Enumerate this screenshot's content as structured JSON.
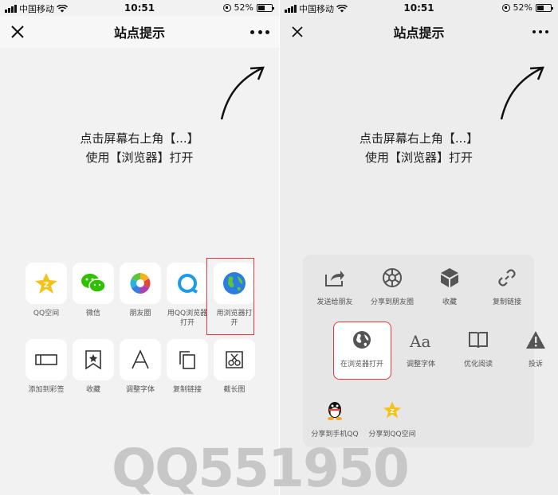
{
  "status": {
    "carrier": "中国移动",
    "time": "10:51",
    "battery": "52%"
  },
  "nav": {
    "title": "站点提示"
  },
  "hint": {
    "line1": "点击屏幕右上角【...】",
    "line2": "使用【浏览器】打开"
  },
  "left_share": {
    "row1": [
      {
        "label": "QQ空间",
        "icon": "qzone-icon"
      },
      {
        "label": "微信",
        "icon": "wechat-icon"
      },
      {
        "label": "朋友圈",
        "icon": "moments-icon"
      },
      {
        "label": "用QQ浏览器打开",
        "icon": "qq-browser-icon"
      },
      {
        "label": "用浏览器打开",
        "icon": "globe-icon"
      }
    ],
    "row2": [
      {
        "label": "添加到彩签",
        "icon": "tag-icon"
      },
      {
        "label": "收藏",
        "icon": "bookmark-icon"
      },
      {
        "label": "调整字体",
        "icon": "font-icon"
      },
      {
        "label": "复制链接",
        "icon": "copy-icon"
      },
      {
        "label": "截长图",
        "icon": "screenshot-icon"
      }
    ]
  },
  "right_share": {
    "items": [
      {
        "label": "发送给朋友",
        "icon": "share-icon"
      },
      {
        "label": "分享到朋友圈",
        "icon": "moments-icon"
      },
      {
        "label": "收藏",
        "icon": "cube-icon"
      },
      {
        "label": "复制链接",
        "icon": "link-icon"
      },
      {
        "label": "在浏览器打开",
        "icon": "globe-icon"
      },
      {
        "label": "调整字体",
        "icon": "font-icon"
      },
      {
        "label": "优化阅读",
        "icon": "book-icon"
      },
      {
        "label": "投诉",
        "icon": "warning-icon"
      },
      {
        "label": "分享到手机QQ",
        "icon": "qq-icon"
      },
      {
        "label": "分享到QQ空间",
        "icon": "qzone-icon"
      }
    ]
  },
  "watermark": {
    "text": "QQ551950"
  },
  "colors": {
    "highlight": "#e0383b",
    "background": "#f2f2f2",
    "sheet": "#e6e6e6"
  }
}
